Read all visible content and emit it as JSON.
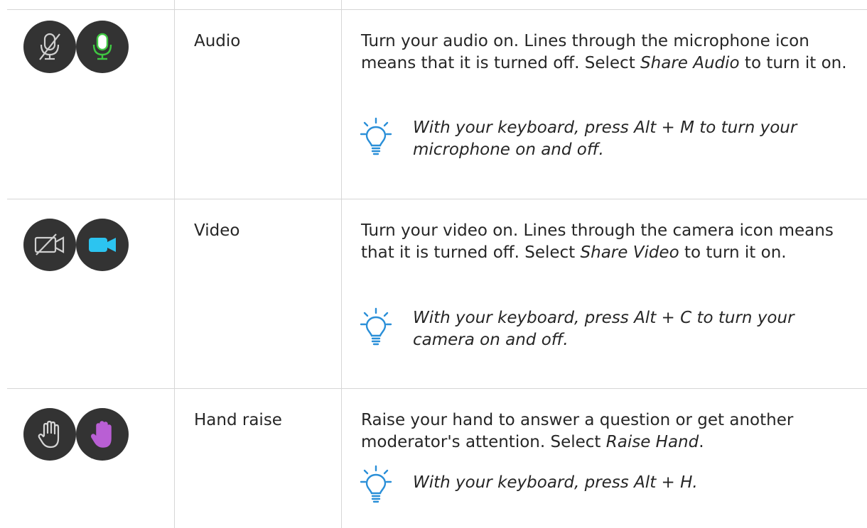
{
  "rows": [
    {
      "name": "Audio",
      "desc_before": "Turn your audio on. Lines through the microphone icon means that it is turned off. Select ",
      "desc_em": "Share Audio",
      "desc_after": " to turn it on.",
      "tip": "With your keyboard, press Alt + M to turn your microphone on and off.",
      "icons": [
        "microphone-off-icon",
        "microphone-on-icon"
      ],
      "active_color": "#3fc842"
    },
    {
      "name": "Video",
      "desc_before": "Turn your video on. Lines through the camera icon means that it is turned off. Select ",
      "desc_em": "Share Video",
      "desc_after": " to turn it on.",
      "tip": "With your keyboard, press Alt + C to turn your camera on and off.",
      "icons": [
        "camera-off-icon",
        "camera-on-icon"
      ],
      "active_color": "#2cc4f0"
    },
    {
      "name": "Hand raise",
      "desc_before": "Raise your hand to answer a question or get another moderator's attention. Select ",
      "desc_em": "Raise Hand",
      "desc_after": ".",
      "tip": "With your keyboard, press Alt + H.",
      "icons": [
        "hand-outline-icon",
        "hand-raised-icon"
      ],
      "active_color": "#b95fd4"
    }
  ],
  "colors": {
    "icon_background": "#333333",
    "tip_bulb": "#2a8fd8",
    "divider": "#d6d6d6"
  }
}
